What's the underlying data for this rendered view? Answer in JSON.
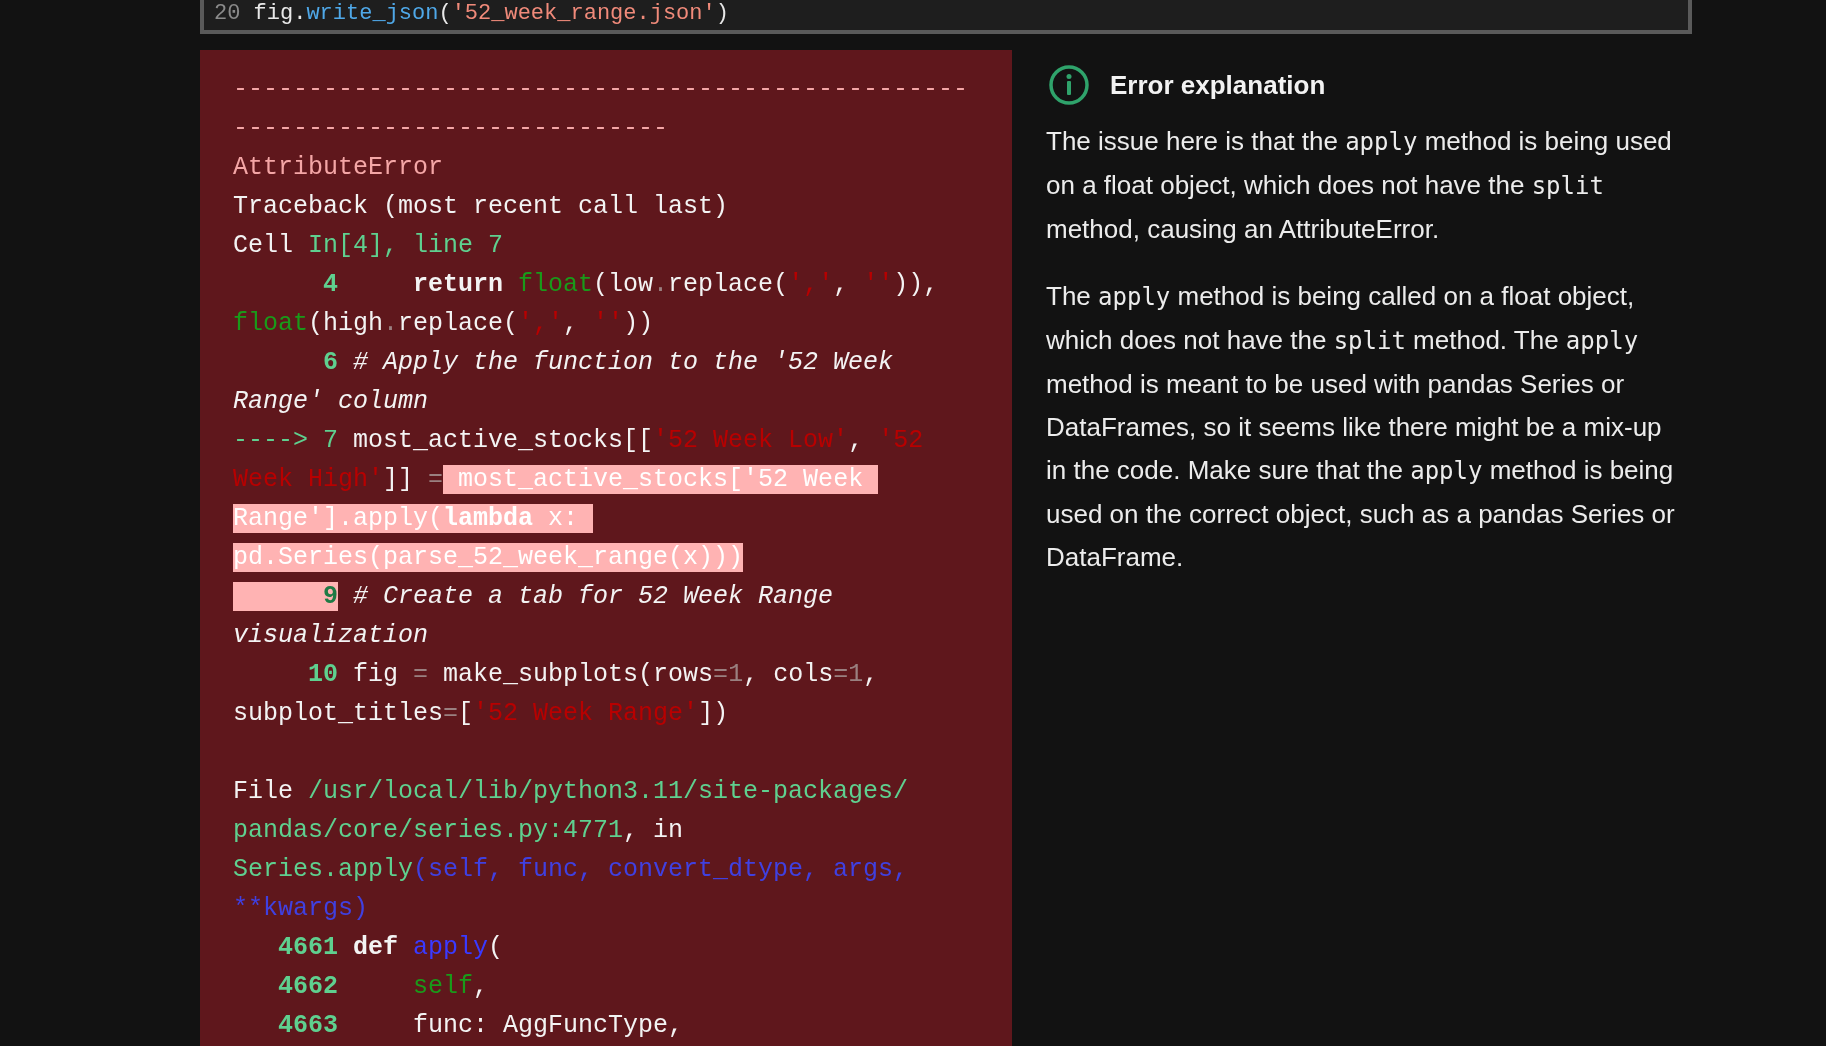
{
  "top_cell": {
    "line": [
      {
        "text": "20",
        "kind": "gutter"
      },
      {
        "text": " fig",
        "kind": "plain"
      },
      {
        "text": ".",
        "kind": "plain"
      },
      {
        "text": "write_json",
        "kind": "method"
      },
      {
        "text": "(",
        "kind": "plain"
      },
      {
        "text": "'52_week_range.json'",
        "kind": "str"
      },
      {
        "text": ")",
        "kind": "plain"
      }
    ]
  },
  "traceback": {
    "lines": [
      [
        {
          "text": "-------------------------------------------------",
          "kind": "error",
          "highlighted": false
        }
      ],
      [
        {
          "text": "-----------------------------",
          "kind": "error",
          "highlighted": false
        }
      ],
      [
        {
          "text": "AttributeError",
          "kind": "error",
          "highlighted": false
        }
      ],
      [
        {
          "text": "Traceback (most recent call last)",
          "kind": "plain",
          "highlighted": false
        }
      ],
      [
        {
          "text": "Cell ",
          "kind": "plain",
          "highlighted": false
        },
        {
          "text": "In[4], line 7",
          "kind": "link",
          "highlighted": false
        }
      ],
      [
        {
          "text": "      4",
          "kind": "lineno",
          "highlighted": false
        },
        {
          "text": "     return",
          "kind": "keyword",
          "highlighted": false
        },
        {
          "text": " float",
          "kind": "builtin",
          "highlighted": false
        },
        {
          "text": "(low",
          "kind": "plain",
          "highlighted": false
        },
        {
          "text": ".",
          "kind": "op",
          "highlighted": false
        },
        {
          "text": "replace(",
          "kind": "plain",
          "highlighted": false
        },
        {
          "text": "','",
          "kind": "string",
          "highlighted": false
        },
        {
          "text": ", ",
          "kind": "plain",
          "highlighted": false
        },
        {
          "text": "''",
          "kind": "string",
          "highlighted": false
        },
        {
          "text": ")),",
          "kind": "plain",
          "highlighted": false
        }
      ],
      [
        {
          "text": "float",
          "kind": "builtin",
          "highlighted": false
        },
        {
          "text": "(high",
          "kind": "plain",
          "highlighted": false
        },
        {
          "text": ".",
          "kind": "op",
          "highlighted": false
        },
        {
          "text": "replace(",
          "kind": "plain",
          "highlighted": false
        },
        {
          "text": "','",
          "kind": "string",
          "highlighted": false
        },
        {
          "text": ", ",
          "kind": "plain",
          "highlighted": false
        },
        {
          "text": "''",
          "kind": "string",
          "highlighted": false
        },
        {
          "text": "))",
          "kind": "plain",
          "highlighted": false
        }
      ],
      [
        {
          "text": "      6",
          "kind": "lineno",
          "highlighted": false
        },
        {
          "text": " # Apply the function to the '52 Week",
          "kind": "comment",
          "highlighted": false
        }
      ],
      [
        {
          "text": "Range' column",
          "kind": "comment",
          "highlighted": false
        }
      ],
      [
        {
          "text": "----> 7",
          "kind": "link",
          "highlighted": false
        },
        {
          "text": " most_active_stocks[[",
          "kind": "plain",
          "highlighted": false
        },
        {
          "text": "'52 Week Low'",
          "kind": "string",
          "highlighted": false
        },
        {
          "text": ", ",
          "kind": "plain",
          "highlighted": false
        },
        {
          "text": "'52",
          "kind": "string",
          "highlighted": false
        }
      ],
      [
        {
          "text": "Week High'",
          "kind": "string",
          "highlighted": false
        },
        {
          "text": "]] ",
          "kind": "plain",
          "highlighted": false
        },
        {
          "text": "=",
          "kind": "op",
          "highlighted": false
        },
        {
          "text": " most_active_stocks['52 Week ",
          "kind": "plain",
          "highlighted": true
        }
      ],
      [
        {
          "text": "Range'].apply(",
          "kind": "plain",
          "highlighted": true
        },
        {
          "text": "lambda",
          "kind": "keyword",
          "highlighted": true
        },
        {
          "text": " x: ",
          "kind": "plain",
          "highlighted": true
        }
      ],
      [
        {
          "text": "pd.Series(parse_52_week_range(x)))",
          "kind": "plain",
          "highlighted": true
        }
      ],
      [
        {
          "text": "      9",
          "kind": "lineno",
          "highlighted": true
        },
        {
          "text": " # Create a tab for 52 Week Range",
          "kind": "comment",
          "highlighted": false
        }
      ],
      [
        {
          "text": "visualization",
          "kind": "comment",
          "highlighted": false
        }
      ],
      [
        {
          "text": "     10",
          "kind": "lineno",
          "highlighted": false
        },
        {
          "text": " fig ",
          "kind": "plain",
          "highlighted": false
        },
        {
          "text": "=",
          "kind": "op",
          "highlighted": false
        },
        {
          "text": " make_subplots(rows",
          "kind": "plain",
          "highlighted": false
        },
        {
          "text": "=",
          "kind": "op",
          "highlighted": false
        },
        {
          "text": "1",
          "kind": "op",
          "highlighted": false
        },
        {
          "text": ", cols",
          "kind": "plain",
          "highlighted": false
        },
        {
          "text": "=",
          "kind": "op",
          "highlighted": false
        },
        {
          "text": "1",
          "kind": "op",
          "highlighted": false
        },
        {
          "text": ",",
          "kind": "plain",
          "highlighted": false
        }
      ],
      [
        {
          "text": "subplot_titles",
          "kind": "plain",
          "highlighted": false
        },
        {
          "text": "=",
          "kind": "op",
          "highlighted": false
        },
        {
          "text": "[",
          "kind": "plain",
          "highlighted": false
        },
        {
          "text": "'52 Week Range'",
          "kind": "string",
          "highlighted": false
        },
        {
          "text": "])",
          "kind": "plain",
          "highlighted": false
        }
      ]
    ]
  },
  "library_frame": {
    "lines": [
      [
        {
          "text": "File ",
          "kind": "plain",
          "highlighted": false
        },
        {
          "text": "/usr/local/lib/python3.11/site-packages/",
          "kind": "link",
          "highlighted": false
        }
      ],
      [
        {
          "text": "pandas/core/series.py:4771",
          "kind": "link",
          "highlighted": false
        },
        {
          "text": ", in",
          "kind": "plain",
          "highlighted": false
        }
      ],
      [
        {
          "text": "Series.apply",
          "kind": "link",
          "highlighted": false
        },
        {
          "text": "(self, func, convert_dtype, args,",
          "kind": "arg",
          "highlighted": false
        }
      ],
      [
        {
          "text": "**kwargs)",
          "kind": "arg",
          "highlighted": false
        }
      ],
      [
        {
          "text": "   4661",
          "kind": "lineno",
          "highlighted": false
        },
        {
          "text": " def",
          "kind": "keyword",
          "highlighted": false
        },
        {
          "text": " apply",
          "kind": "name",
          "highlighted": false
        },
        {
          "text": "(",
          "kind": "plain",
          "highlighted": false
        }
      ],
      [
        {
          "text": "   4662",
          "kind": "lineno",
          "highlighted": false
        },
        {
          "text": "     self",
          "kind": "builtin",
          "highlighted": false
        },
        {
          "text": ",",
          "kind": "plain",
          "highlighted": false
        }
      ],
      [
        {
          "text": "   4663",
          "kind": "lineno",
          "highlighted": false
        },
        {
          "text": "     func: AggFuncType,",
          "kind": "plain",
          "highlighted": false
        }
      ]
    ]
  },
  "explanation": {
    "title": "Error explanation",
    "paragraphs": [
      [
        {
          "text": "The issue here is that the ",
          "kind": "text"
        },
        {
          "text": "apply",
          "kind": "code"
        },
        {
          "text": " method is being used on a float object, which does not have the ",
          "kind": "text"
        },
        {
          "text": "split",
          "kind": "code"
        },
        {
          "text": " method, causing an AttributeError.",
          "kind": "text"
        }
      ],
      [
        {
          "text": "The ",
          "kind": "text"
        },
        {
          "text": "apply",
          "kind": "code"
        },
        {
          "text": " method is being called on a float object, which does not have the ",
          "kind": "text"
        },
        {
          "text": "split",
          "kind": "code"
        },
        {
          "text": " method. The ",
          "kind": "text"
        },
        {
          "text": "apply",
          "kind": "code"
        },
        {
          "text": " method is meant to be used with pandas Series or DataFrames, so it seems like there might be a mix-up in the code. Make sure that the ",
          "kind": "text"
        },
        {
          "text": "apply",
          "kind": "code"
        },
        {
          "text": " method is being used on the correct object, such as a pandas Series or DataFrame.",
          "kind": "text"
        }
      ]
    ]
  }
}
